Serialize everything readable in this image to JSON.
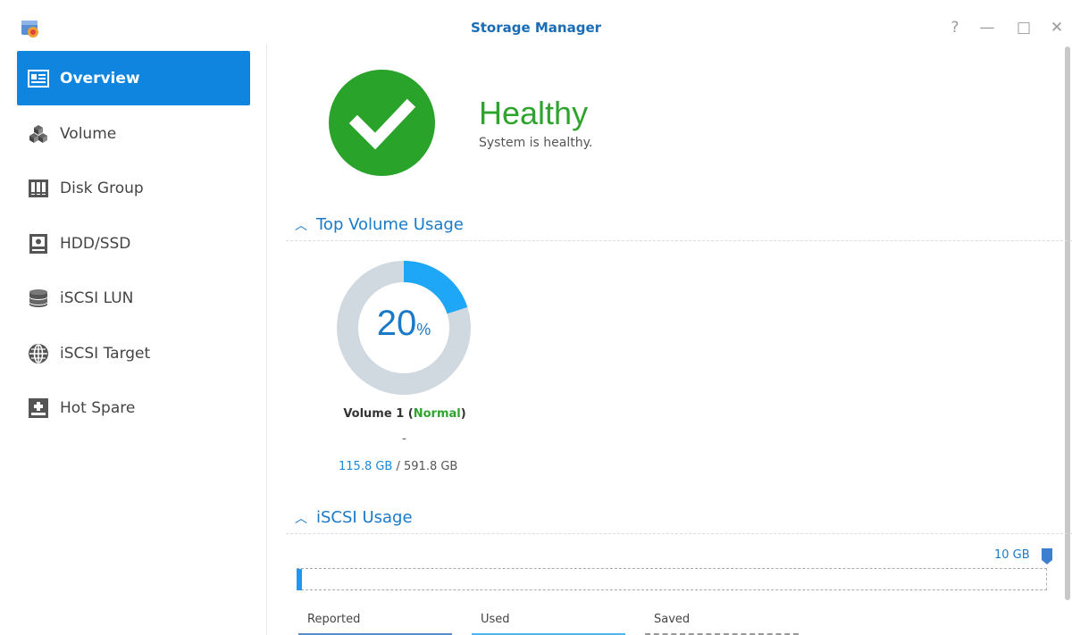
{
  "window": {
    "title": "Storage Manager"
  },
  "window_controls": {
    "help": "?",
    "minimize": "—",
    "maximize": "□",
    "close": "✕"
  },
  "sidebar": {
    "items": [
      {
        "label": "Overview",
        "icon": "overview-icon",
        "active": true
      },
      {
        "label": "Volume",
        "icon": "volume-icon",
        "active": false
      },
      {
        "label": "Disk Group",
        "icon": "disk-group-icon",
        "active": false
      },
      {
        "label": "HDD/SSD",
        "icon": "hdd-icon",
        "active": false
      },
      {
        "label": "iSCSI LUN",
        "icon": "iscsi-lun-icon",
        "active": false
      },
      {
        "label": "iSCSI Target",
        "icon": "iscsi-target-icon",
        "active": false
      },
      {
        "label": "Hot Spare",
        "icon": "hot-spare-icon",
        "active": false
      }
    ]
  },
  "health": {
    "status": "Healthy",
    "message": "System is healthy.",
    "color": "#29a329"
  },
  "top_volume_usage": {
    "heading": "Top Volume Usage",
    "percent": "20",
    "percent_unit": "%",
    "volume_name": "Volume 1",
    "volume_status": "Normal",
    "dash": "-",
    "used": "115.8 GB",
    "separator": " / ",
    "total": "591.8 GB",
    "fraction": 0.2
  },
  "iscsi_usage": {
    "heading": "iSCSI Usage",
    "max_label": "10 GB",
    "legend": {
      "reported": "Reported",
      "used": "Used",
      "saved": "Saved"
    }
  },
  "colors": {
    "accent": "#0f85e0",
    "healthy": "#2ea42e",
    "donut_used": "#1ea7f7",
    "donut_free": "#d0d8e0"
  }
}
